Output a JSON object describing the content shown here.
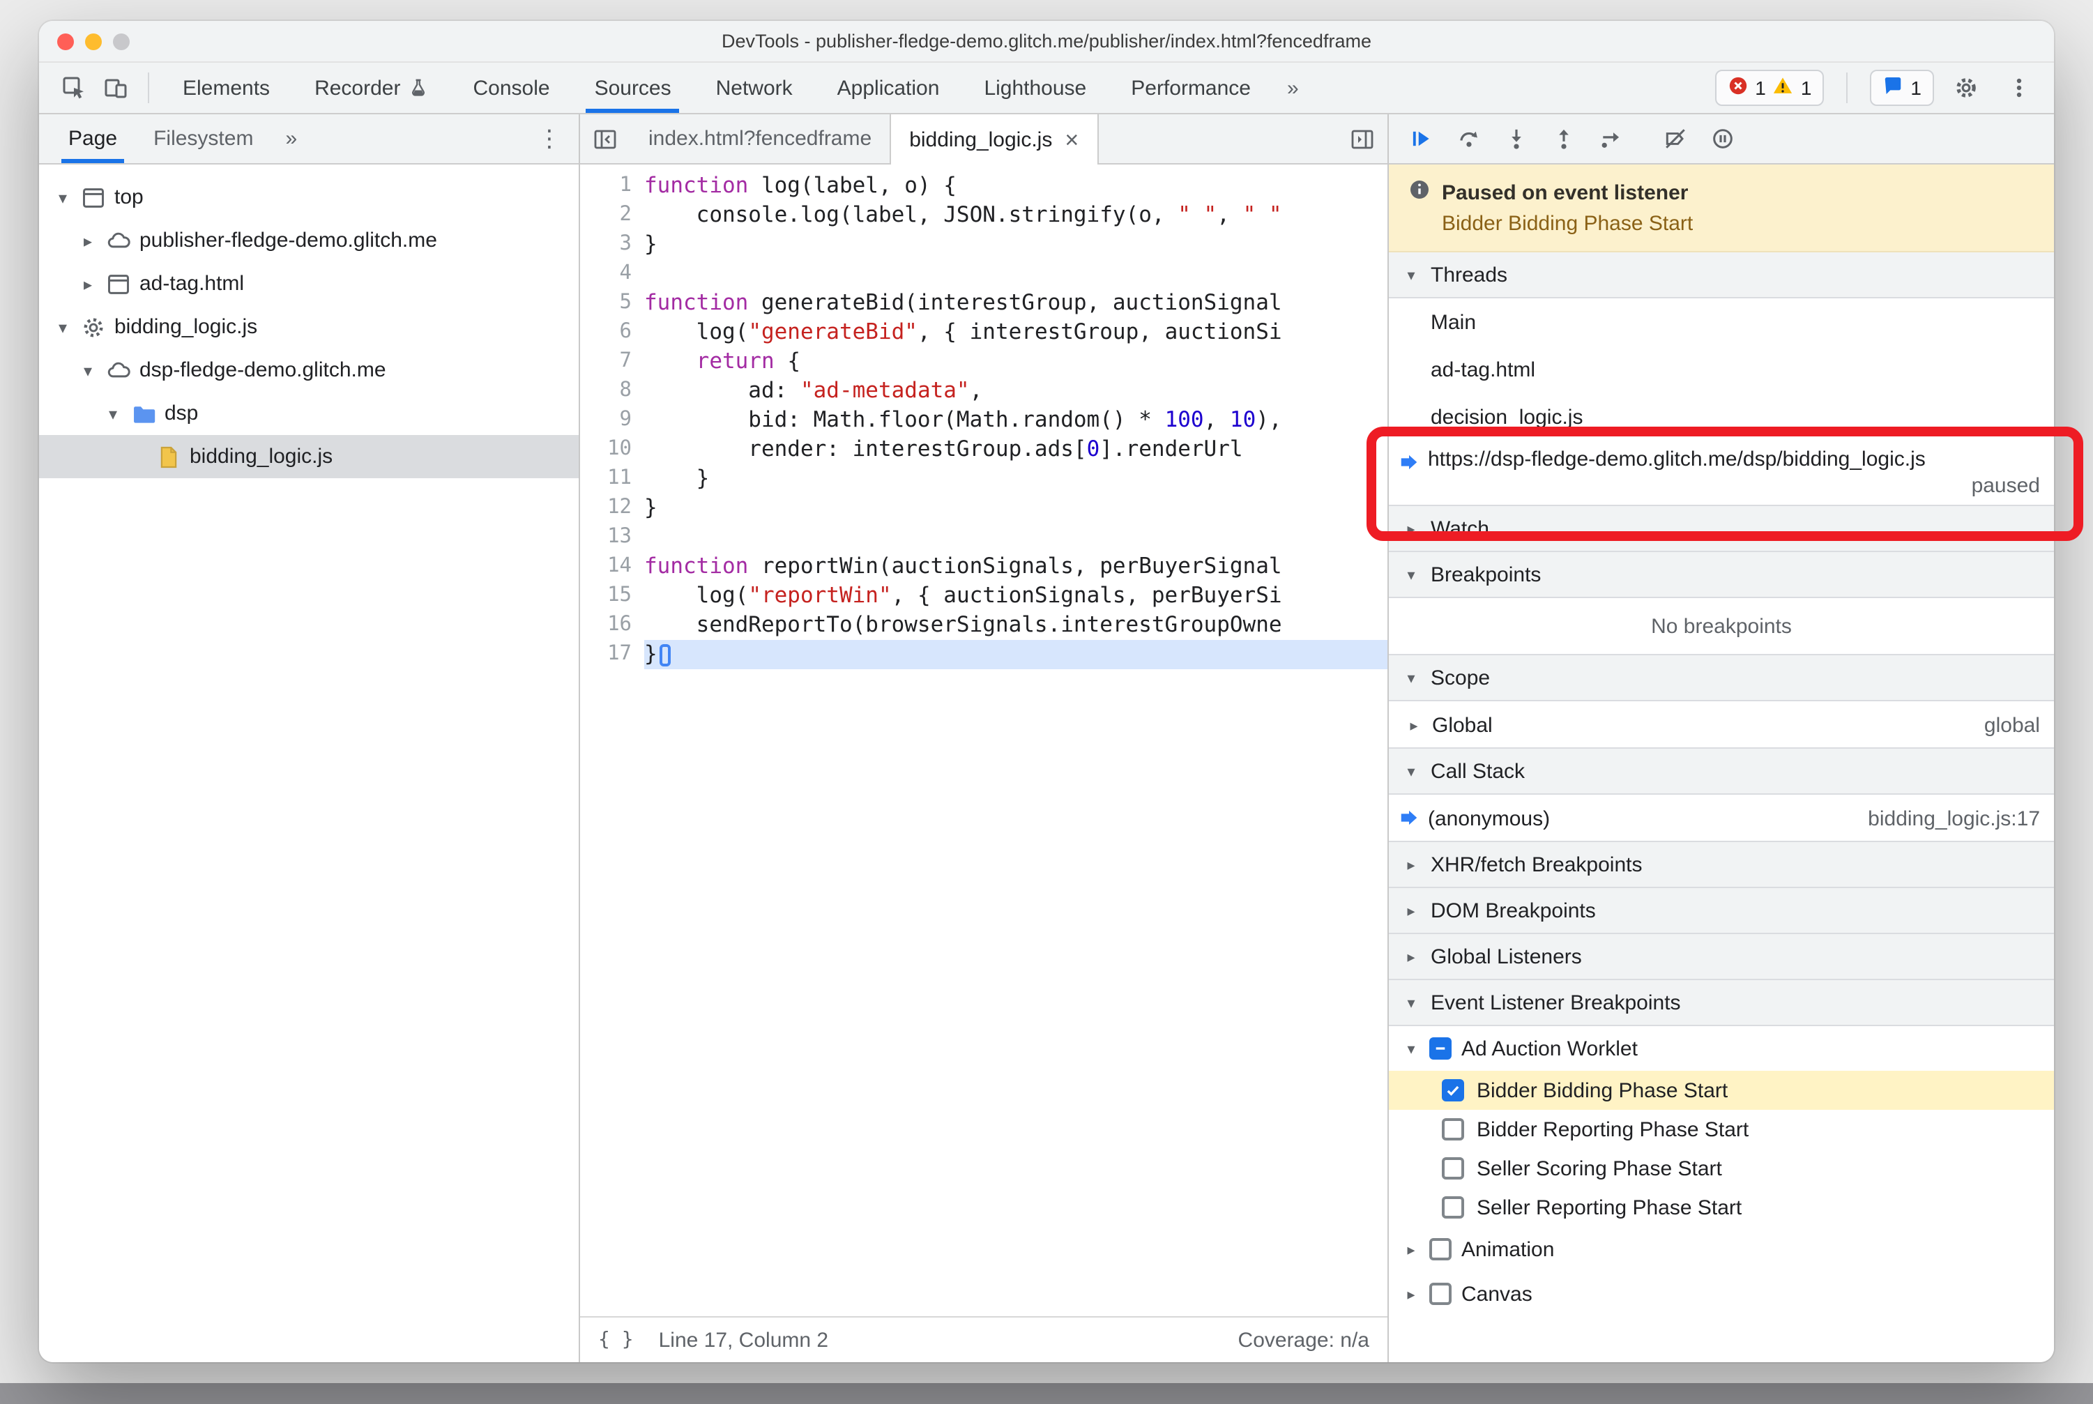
{
  "colors": {
    "accent": "#1a73e8",
    "error": "#d93025",
    "warning": "#fbbc04",
    "annotation": "#ee1c24",
    "highlight_row": "#fff3c5",
    "exec_line": "#d7e6fd",
    "paused_banner_bg": "#fcf1cd"
  },
  "window": {
    "title": "DevTools - publisher-fledge-demo.glitch.me/publisher/index.html?fencedframe"
  },
  "main_toolbar": {
    "tabs": [
      "Elements",
      "Recorder",
      "Console",
      "Sources",
      "Network",
      "Application",
      "Lighthouse",
      "Performance"
    ],
    "active_tab": "Sources",
    "overflow": "»",
    "badges": {
      "errors": "1",
      "warnings": "1",
      "messages": "1"
    }
  },
  "navigator": {
    "tabs": [
      "Page",
      "Filesystem"
    ],
    "active_tab": "Page",
    "overflow": "»",
    "more": "⋮",
    "tree": [
      {
        "label": "top",
        "icon": "frame",
        "state": "expanded",
        "indent": 0
      },
      {
        "label": "publisher-fledge-demo.glitch.me",
        "icon": "cloud",
        "state": "collapsed",
        "indent": 1
      },
      {
        "label": "ad-tag.html",
        "icon": "frame",
        "state": "collapsed",
        "indent": 1
      },
      {
        "label": "bidding_logic.js",
        "icon": "worklet",
        "state": "expanded",
        "indent": 0
      },
      {
        "label": "dsp-fledge-demo.glitch.me",
        "icon": "cloud",
        "state": "expanded",
        "indent": 1
      },
      {
        "label": "dsp",
        "icon": "folder",
        "state": "expanded",
        "indent": 2
      },
      {
        "label": "bidding_logic.js",
        "icon": "file",
        "state": "leaf",
        "indent": 3,
        "selected": true
      }
    ]
  },
  "editor": {
    "tabs": [
      {
        "label": "index.html?fencedframe",
        "active": false,
        "closable": false
      },
      {
        "label": "bidding_logic.js",
        "active": true,
        "closable": true
      }
    ],
    "close_glyph": "×",
    "paused_line": 17,
    "lines": [
      {
        "n": 1,
        "seg": [
          [
            "kw",
            "function"
          ],
          [
            "pl",
            " log(label, o) {"
          ]
        ]
      },
      {
        "n": 2,
        "seg": [
          [
            "pl",
            "    console.log(label, JSON.stringify(o, "
          ],
          [
            "str",
            "\" \""
          ],
          [
            "pl",
            ", "
          ],
          [
            "str",
            "\" \""
          ]
        ]
      },
      {
        "n": 3,
        "seg": [
          [
            "pl",
            "}"
          ]
        ]
      },
      {
        "n": 4,
        "seg": []
      },
      {
        "n": 5,
        "seg": [
          [
            "kw",
            "function"
          ],
          [
            "pl",
            " generateBid(interestGroup, auctionSignal"
          ]
        ]
      },
      {
        "n": 6,
        "seg": [
          [
            "pl",
            "    log("
          ],
          [
            "str",
            "\"generateBid\""
          ],
          [
            "pl",
            ", { interestGroup, auctionSi"
          ]
        ]
      },
      {
        "n": 7,
        "seg": [
          [
            "pl",
            "    "
          ],
          [
            "kw",
            "return"
          ],
          [
            "pl",
            " {"
          ]
        ]
      },
      {
        "n": 8,
        "seg": [
          [
            "pl",
            "        ad: "
          ],
          [
            "str",
            "\"ad-metadata\""
          ],
          [
            "pl",
            ","
          ]
        ]
      },
      {
        "n": 9,
        "seg": [
          [
            "pl",
            "        bid: Math.floor(Math.random() * "
          ],
          [
            "num",
            "100"
          ],
          [
            "pl",
            ", "
          ],
          [
            "num",
            "10"
          ],
          [
            "pl",
            "),"
          ]
        ]
      },
      {
        "n": 10,
        "seg": [
          [
            "pl",
            "        render: interestGroup.ads["
          ],
          [
            "num",
            "0"
          ],
          [
            "pl",
            "].renderUrl"
          ]
        ]
      },
      {
        "n": 11,
        "seg": [
          [
            "pl",
            "    }"
          ]
        ]
      },
      {
        "n": 12,
        "seg": [
          [
            "pl",
            "}"
          ]
        ]
      },
      {
        "n": 13,
        "seg": []
      },
      {
        "n": 14,
        "seg": [
          [
            "kw",
            "function"
          ],
          [
            "pl",
            " reportWin(auctionSignals, perBuyerSignal"
          ]
        ]
      },
      {
        "n": 15,
        "seg": [
          [
            "pl",
            "    log("
          ],
          [
            "str",
            "\"reportWin\""
          ],
          [
            "pl",
            ", { auctionSignals, perBuyerSi"
          ]
        ]
      },
      {
        "n": 16,
        "seg": [
          [
            "pl",
            "    sendReportTo(browserSignals.interestGroupOwne"
          ]
        ]
      },
      {
        "n": 17,
        "seg": [
          [
            "pl",
            "}"
          ]
        ]
      }
    ],
    "status_bar": {
      "brackets": "{ }",
      "line_col": "Line 17, Column 2",
      "coverage": "Coverage: n/a"
    }
  },
  "debugger": {
    "banner": {
      "title": "Paused on event listener",
      "subtitle": "Bidder Bidding Phase Start"
    },
    "threads": {
      "title": "Threads",
      "rows": [
        {
          "label": "Main"
        },
        {
          "label": "ad-tag.html"
        },
        {
          "label": "decision_logic.js"
        },
        {
          "label": "https://dsp-fledge-demo.glitch.me/dsp/bidding_logic.js",
          "current": true,
          "status": "paused"
        }
      ]
    },
    "watch": {
      "title": "Watch"
    },
    "breakpoints": {
      "title": "Breakpoints",
      "empty": "No breakpoints"
    },
    "scope": {
      "title": "Scope",
      "rows": [
        {
          "label": "Global",
          "value": "global"
        }
      ]
    },
    "call_stack": {
      "title": "Call Stack",
      "rows": [
        {
          "label": "(anonymous)",
          "location": "bidding_logic.js:17",
          "current": true
        }
      ]
    },
    "collapsed_sections": [
      "XHR/fetch Breakpoints",
      "DOM Breakpoints",
      "Global Listeners"
    ],
    "event_listener_breakpoints": {
      "title": "Event Listener Breakpoints",
      "categories": [
        {
          "label": "Ad Auction Worklet",
          "checkbox": "indeterminate",
          "expanded": true,
          "children": [
            {
              "label": "Bidder Bidding Phase Start",
              "checked": true,
              "highlighted": true
            },
            {
              "label": "Bidder Reporting Phase Start",
              "checked": false
            },
            {
              "label": "Seller Scoring Phase Start",
              "checked": false
            },
            {
              "label": "Seller Reporting Phase Start",
              "checked": false
            }
          ]
        },
        {
          "label": "Animation",
          "checkbox": "unchecked",
          "expanded": false,
          "children": []
        },
        {
          "label": "Canvas",
          "checkbox": "unchecked",
          "expanded": false,
          "children": []
        }
      ]
    }
  }
}
